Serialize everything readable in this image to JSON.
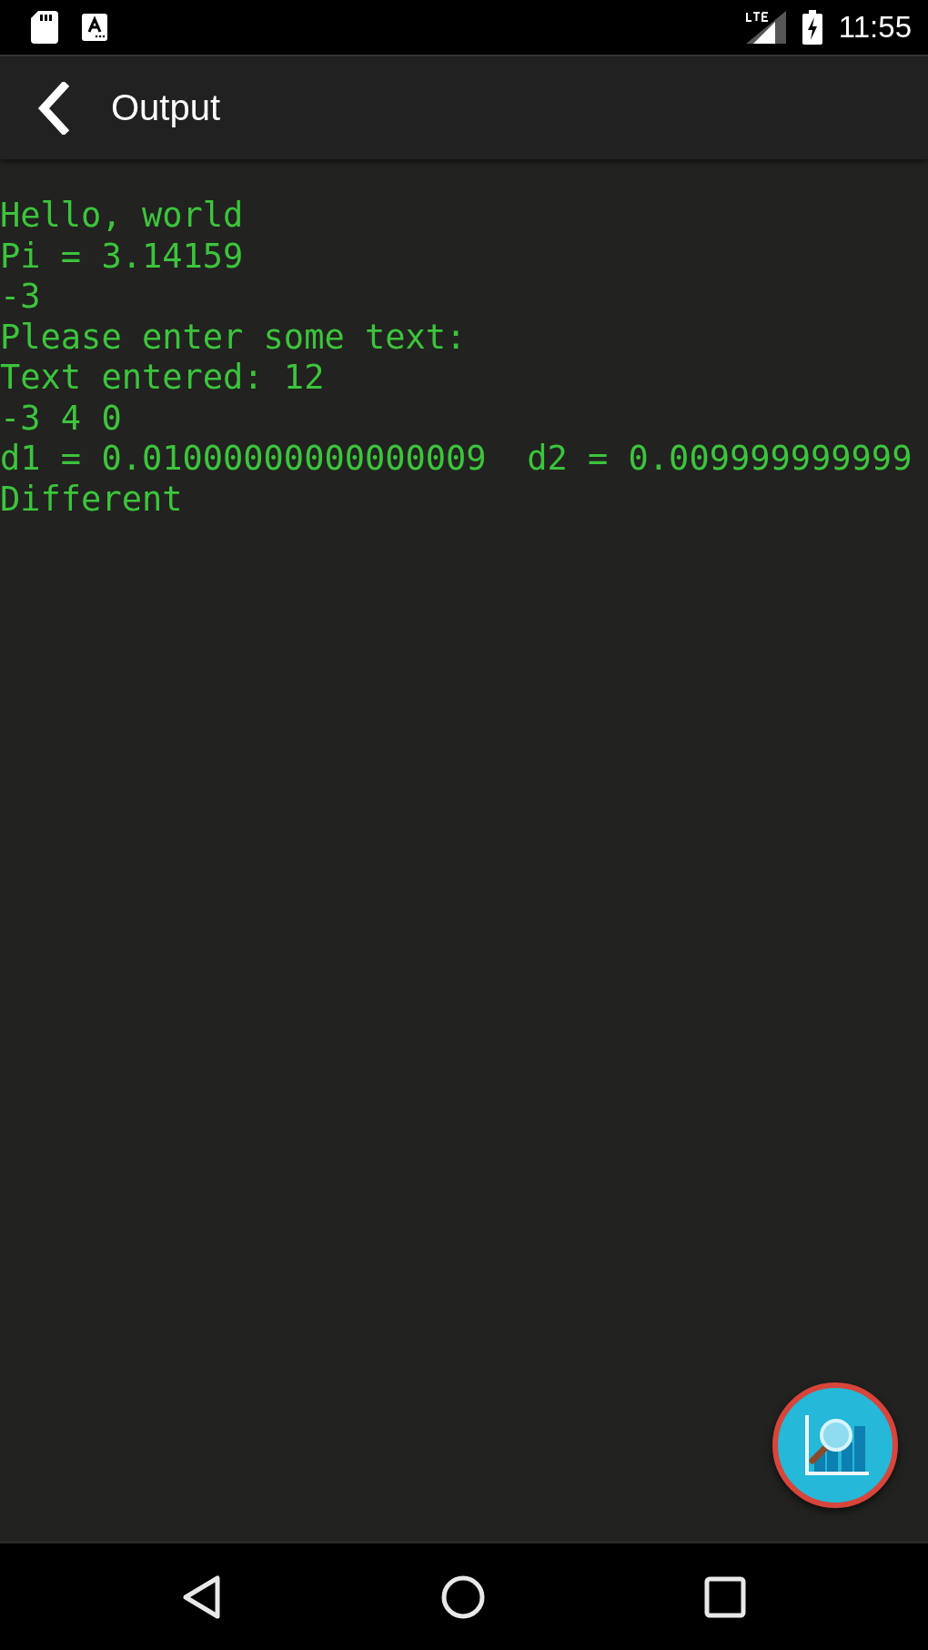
{
  "status_bar": {
    "time": "11:55"
  },
  "app_bar": {
    "title": "Output"
  },
  "output": {
    "lines": [
      "Hello, world",
      "Pi = 3.14159",
      "-3",
      "Please enter some text:",
      "Text entered: 12",
      "-3 4 0",
      "d1 = 0.01000000000000009  d2 = 0.009999999999",
      "Different"
    ]
  }
}
